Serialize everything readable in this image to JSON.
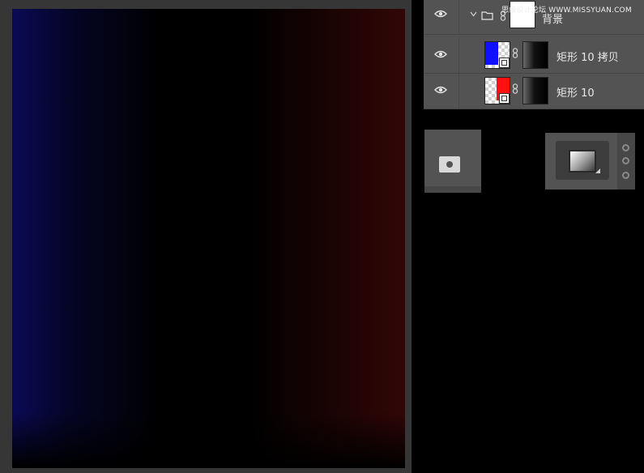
{
  "canvas": {
    "gradient_left_color": "#0a0a56",
    "gradient_mid_color": "#000000",
    "gradient_right_color": "#330606"
  },
  "layers_panel": {
    "watermark": "思缘设计论坛 WWW.MISSYUAN.COM",
    "group": {
      "name": "背景",
      "icons": [
        "eye-icon",
        "chevron-down-icon",
        "folder-icon",
        "link-icon"
      ]
    },
    "layers": [
      {
        "name": "矩形 10 拷贝",
        "fill_color": "#1010ff",
        "icons": [
          "eye-icon",
          "link-icon",
          "shape-badge-icon"
        ]
      },
      {
        "name": "矩形 10",
        "fill_color": "#ff1010",
        "icons": [
          "eye-icon",
          "link-icon",
          "shape-badge-icon"
        ]
      }
    ]
  },
  "toolbar_snippets": {
    "mask_icon": "add-mask-icon",
    "adjustment_icon": "gradient-fill-icon"
  }
}
